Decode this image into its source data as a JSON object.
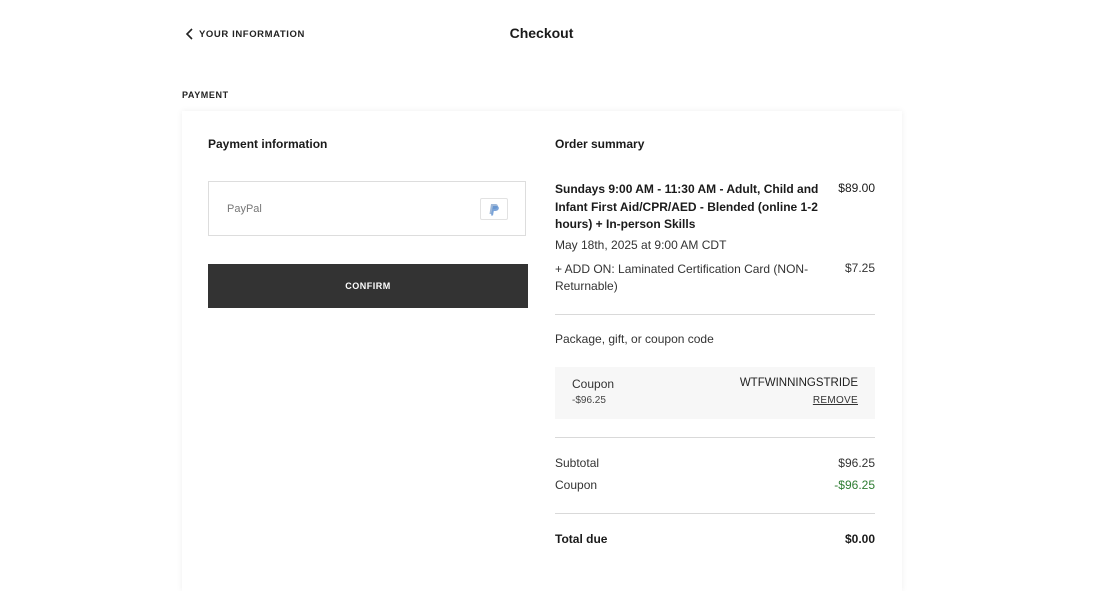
{
  "header": {
    "back_label": "YOUR INFORMATION",
    "title": "Checkout"
  },
  "section_label": "PAYMENT",
  "payment": {
    "title": "Payment information",
    "method_label": "PayPal",
    "method_icon": "paypal-icon",
    "confirm_label": "CONFIRM"
  },
  "summary": {
    "title": "Order summary",
    "item": {
      "name": "Sundays 9:00 AM - 11:30 AM - Adult, Child and Infant First Aid/CPR/AED - Blended (online 1-2 hours) + In-person Skills",
      "price": "$89.00",
      "date": "May 18th, 2025 at 9:00 AM CDT"
    },
    "addon": {
      "name": "+ ADD ON: Laminated Certification Card (NON-Returnable)",
      "price": "$7.25"
    },
    "coupon_prompt": "Package, gift, or coupon code",
    "coupon": {
      "label": "Coupon",
      "amount": "-$96.25",
      "code": "WTFWINNINGSTRIDE",
      "remove_label": "REMOVE"
    },
    "subtotal_label": "Subtotal",
    "subtotal_value": "$96.25",
    "coupon_row_label": "Coupon",
    "coupon_row_value": "-$96.25",
    "total_label": "Total due",
    "total_value": "$0.00"
  },
  "colors": {
    "button_bg": "#333333",
    "discount_green": "#2e7d32",
    "coupon_bg": "#f7f7f7"
  }
}
